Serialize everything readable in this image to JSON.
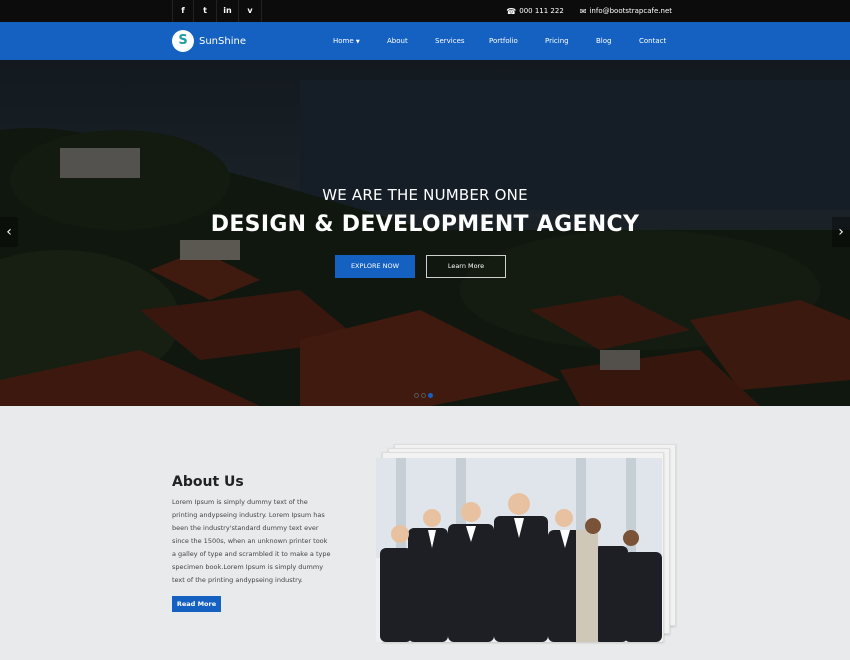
{
  "topbar": {
    "social": [
      {
        "icon": "facebook-icon",
        "glyph": "f"
      },
      {
        "icon": "twitter-icon",
        "glyph": "t"
      },
      {
        "icon": "linkedin-icon",
        "glyph": "in"
      },
      {
        "icon": "vimeo-icon",
        "glyph": "v"
      }
    ],
    "phone": "000 111 222",
    "email": "info@bootstrapcafe.net"
  },
  "nav": {
    "brand": "SunShine",
    "logo_letter": "S",
    "items": [
      {
        "label": "Home",
        "dropdown": true
      },
      {
        "label": "About"
      },
      {
        "label": "Services"
      },
      {
        "label": "Portfolio"
      },
      {
        "label": "Pricing"
      },
      {
        "label": "Blog"
      },
      {
        "label": "Contact"
      }
    ]
  },
  "hero": {
    "subtitle": "WE ARE THE NUMBER ONE",
    "title": "DESIGN & DEVELOPMENT AGENCY",
    "primary_button": "EXPLORE NOW",
    "secondary_button": "Learn More",
    "slides": 3,
    "active_slide": 3
  },
  "about": {
    "title": "About Us",
    "text": "Lorem Ipsum is simply dummy text of the printing andypseing industry. Lorem Ipsum has been the industry'standard dummy text ever since the 1500s, when an unknown printer took a galley of type and scrambled it to make a type specimen book.Lorem Ipsum is simply dummy text of the printing andypseing industry.",
    "button": "Read More"
  },
  "colors": {
    "primary": "#1561c1",
    "topbar": "#0c0c0c",
    "section_bg": "#e9eaeb",
    "roof": "#8a3a22"
  }
}
